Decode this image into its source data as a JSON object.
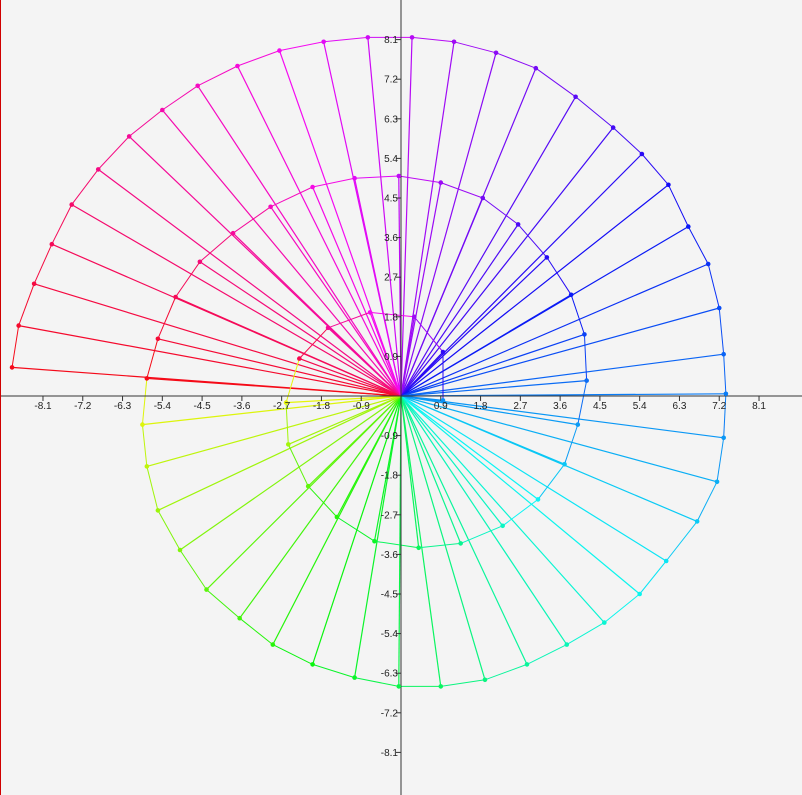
{
  "chart_data": {
    "type": "scatter",
    "title": "",
    "xlabel": "",
    "ylabel": "",
    "grid": false,
    "legend": "none",
    "xlim": [
      -9.1,
      9.1
    ],
    "ylim": [
      -9.0,
      9.0
    ],
    "x_ticks": [
      -8.1,
      -7.2,
      -6.3,
      -5.4,
      -4.5,
      -3.6,
      -2.7,
      -1.8,
      -0.9,
      0.9,
      1.8,
      2.7,
      3.6,
      4.5,
      5.4,
      6.3,
      7.2,
      8.1
    ],
    "x_tick_labels": [
      "-8.1",
      "-7.2",
      "-6.3",
      "-5.4",
      "-4.5",
      "-3.6",
      "-2.7",
      "-1.8",
      "-0.9",
      "0.9",
      "1.8",
      "2.7",
      "3.6",
      "4.5",
      "5.4",
      "6.3",
      "7.2",
      "8.1"
    ],
    "y_ticks": [
      8.1,
      7.2,
      6.3,
      5.4,
      4.5,
      3.6,
      2.7,
      1.8,
      0.9,
      -0.9,
      -1.8,
      -2.7,
      -3.6,
      -4.5,
      -5.4,
      -6.3,
      -7.2,
      -8.1
    ],
    "y_tick_labels": [
      "8.1",
      "7.2",
      "6.3",
      "5.4",
      "4.5",
      "3.6",
      "2.7",
      "1.8",
      "0.9",
      "-0.9",
      "-1.8",
      "-2.7",
      "-3.6",
      "-4.5",
      "-5.4",
      "-6.3",
      "-7.2",
      "-8.1"
    ],
    "axis_color": "#333333",
    "frame_color": "#d00000",
    "background": "#f4f4f4",
    "series": [
      {
        "color_rule": "hue by polar angle, red at the start, cycling through orange, yellow, green, cyan, blue, violet",
        "points": [
          [
            -8.8,
            0.65
          ],
          [
            -8.65,
            1.6
          ],
          [
            -8.3,
            2.55
          ],
          [
            -7.9,
            3.45
          ],
          [
            -7.45,
            4.35
          ],
          [
            -6.85,
            5.15
          ],
          [
            -6.15,
            5.9
          ],
          [
            -5.4,
            6.5
          ],
          [
            -4.6,
            7.05
          ],
          [
            -3.7,
            7.5
          ],
          [
            -2.75,
            7.85
          ],
          [
            -1.75,
            8.05
          ],
          [
            -0.75,
            8.15
          ],
          [
            0.25,
            8.15
          ],
          [
            1.2,
            8.05
          ],
          [
            2.15,
            7.8
          ],
          [
            3.05,
            7.45
          ],
          [
            3.95,
            6.8
          ],
          [
            4.8,
            6.1
          ],
          [
            5.45,
            5.5
          ],
          [
            6.05,
            4.8
          ],
          [
            6.5,
            3.85
          ],
          [
            6.95,
            3.0
          ],
          [
            7.2,
            2.0
          ],
          [
            7.3,
            0.95
          ],
          [
            7.35,
            0.05
          ],
          [
            7.3,
            -0.95
          ],
          [
            7.15,
            -1.95
          ],
          [
            6.7,
            -2.85
          ],
          [
            6.0,
            -3.75
          ],
          [
            5.4,
            -4.5
          ],
          [
            4.6,
            -5.15
          ],
          [
            3.75,
            -5.65
          ],
          [
            2.85,
            -6.1
          ],
          [
            1.9,
            -6.45
          ],
          [
            0.9,
            -6.6
          ],
          [
            -0.05,
            -6.6
          ],
          [
            -1.05,
            -6.4
          ],
          [
            -2.0,
            -6.1
          ],
          [
            -2.9,
            -5.65
          ],
          [
            -3.65,
            -5.05
          ],
          [
            -4.4,
            -4.4
          ],
          [
            -5.0,
            -3.5
          ],
          [
            -5.5,
            -2.6
          ],
          [
            -5.75,
            -1.6
          ],
          [
            -5.85,
            -0.65
          ],
          [
            -5.75,
            0.4
          ],
          [
            -5.5,
            1.3
          ],
          [
            -5.1,
            2.25
          ],
          [
            -4.55,
            3.05
          ],
          [
            -3.8,
            3.7
          ],
          [
            -2.95,
            4.3
          ],
          [
            -2.0,
            4.75
          ],
          [
            -1.05,
            4.95
          ],
          [
            -0.05,
            5.0
          ],
          [
            0.9,
            4.85
          ],
          [
            1.85,
            4.5
          ],
          [
            2.65,
            3.9
          ],
          [
            3.3,
            3.15
          ],
          [
            3.85,
            2.3
          ],
          [
            4.15,
            1.4
          ],
          [
            4.2,
            0.35
          ],
          [
            4.0,
            -0.65
          ],
          [
            3.7,
            -1.55
          ],
          [
            3.1,
            -2.35
          ],
          [
            2.3,
            -2.95
          ],
          [
            1.35,
            -3.35
          ],
          [
            0.4,
            -3.45
          ],
          [
            -0.6,
            -3.3
          ],
          [
            -1.45,
            -2.75
          ],
          [
            -2.1,
            -2.05
          ],
          [
            -2.55,
            -1.1
          ],
          [
            -2.6,
            -0.15
          ],
          [
            -2.3,
            0.85
          ],
          [
            -1.65,
            1.55
          ],
          [
            -0.7,
            1.9
          ],
          [
            0.3,
            1.8
          ],
          [
            0.95,
            1.0
          ],
          [
            0.95,
            -0.1
          ]
        ]
      }
    ]
  }
}
